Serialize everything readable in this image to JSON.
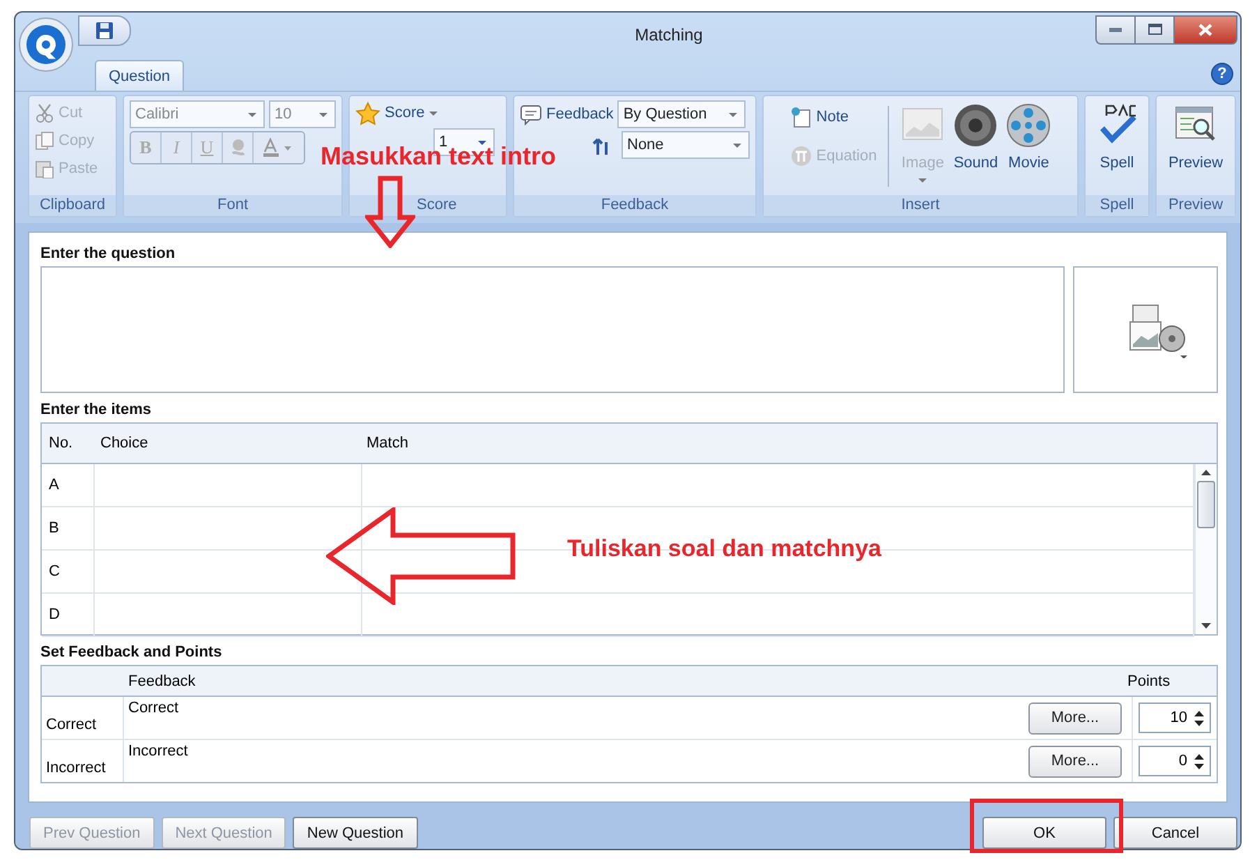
{
  "window": {
    "title": "Matching"
  },
  "ribbon": {
    "tabs": [
      {
        "label": "Question",
        "selected": true
      }
    ],
    "help": "?",
    "groups": [
      {
        "kind": "clipboard",
        "label": "Clipboard",
        "items": [
          {
            "label": "Cut",
            "disabled": true
          },
          {
            "label": "Copy",
            "disabled": true
          },
          {
            "label": "Paste",
            "disabled": true
          }
        ]
      },
      {
        "kind": "font",
        "label": "Font",
        "font": "Calibri",
        "size": "10",
        "format": [
          {
            "label": "B"
          },
          {
            "label": "I"
          },
          {
            "label": "U"
          }
        ],
        "disabled": true
      },
      {
        "kind": "score",
        "label": "Score",
        "button": "Score",
        "attempts": "1"
      },
      {
        "kind": "feedback",
        "label": "Feedback",
        "feedback_label": "Feedback",
        "feedback_value": "By Question",
        "branching_value": "None"
      },
      {
        "kind": "insert",
        "label": "Insert",
        "items": [
          {
            "kind": "small",
            "label": "Note",
            "disabled": false
          },
          {
            "kind": "small",
            "label": "Equation",
            "disabled": true
          },
          {
            "kind": "large",
            "label": "Image",
            "disabled": true
          },
          {
            "kind": "large",
            "label": "Sound",
            "disabled": false
          },
          {
            "kind": "large",
            "label": "Movie",
            "disabled": false
          }
        ]
      },
      {
        "kind": "spell",
        "label": "Spell",
        "button": "Spell"
      },
      {
        "kind": "preview",
        "label": "Preview",
        "button": "Preview"
      }
    ]
  },
  "question": {
    "label": "Enter the question"
  },
  "items": {
    "label": "Enter the items",
    "columns": [
      "No.",
      "Choice",
      "Match"
    ],
    "rows": [
      {
        "no": "A"
      },
      {
        "no": "B"
      },
      {
        "no": "C"
      },
      {
        "no": "D"
      }
    ]
  },
  "feedback": {
    "label": "Set Feedback and Points",
    "columns": [
      "Feedback",
      "Points"
    ],
    "rows": [
      {
        "label": "Correct",
        "feedback": "Correct",
        "more": "More...",
        "points": "10"
      },
      {
        "label": "Incorrect",
        "feedback": "Incorrect",
        "more": "More...",
        "points": "0"
      }
    ]
  },
  "footer": {
    "buttons": [
      {
        "label": "Prev Question",
        "disabled": true
      },
      {
        "label": "Next Question",
        "disabled": true
      },
      {
        "label": "New Question",
        "disabled": false
      },
      {
        "label": "OK",
        "disabled": false
      },
      {
        "label": "Cancel",
        "disabled": false
      }
    ]
  },
  "annotations": [
    {
      "kind": "label",
      "text": "Masukkan text intro"
    },
    {
      "kind": "arrow-down"
    },
    {
      "kind": "label",
      "text": "Tuliskan soal dan matchnya"
    },
    {
      "kind": "arrow-left"
    },
    {
      "kind": "box"
    }
  ]
}
